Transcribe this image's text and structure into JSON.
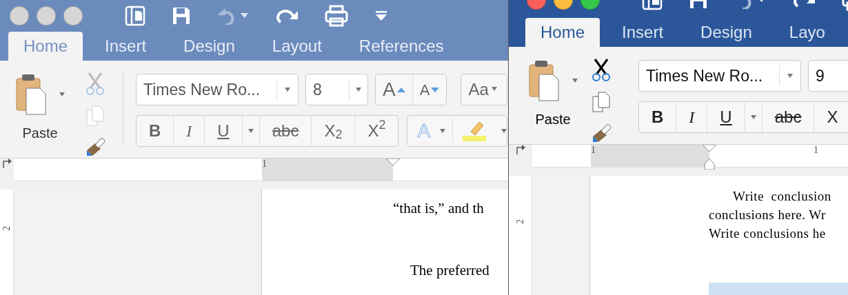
{
  "windows": [
    {
      "active": false,
      "tabs": [
        {
          "label": "Home",
          "selected": true
        },
        {
          "label": "Insert",
          "selected": false
        },
        {
          "label": "Design",
          "selected": false
        },
        {
          "label": "Layout",
          "selected": false
        },
        {
          "label": "References",
          "selected": false
        }
      ],
      "paste_label": "Paste",
      "font_name": "Times New Ro...",
      "font_size": "8",
      "font_tools": [
        {
          "kind": "grow",
          "label": "A"
        },
        {
          "kind": "shrink",
          "label": "A"
        },
        {
          "kind": "case",
          "label": "Aa"
        }
      ],
      "format_buttons": [
        {
          "kind": "bold",
          "label": "B"
        },
        {
          "kind": "italic",
          "label": "I"
        },
        {
          "kind": "underline",
          "label": "U"
        },
        {
          "kind": "strike",
          "label": "abc"
        },
        {
          "kind": "script",
          "label": "X$_{2}$"
        },
        {
          "kind": "script",
          "label": "X$^{2}$"
        }
      ],
      "effects_label": "A",
      "ruler_label": "1",
      "vertical_ruler_label": "2",
      "document_lines": [
        {
          "text": "“that is,” and th",
          "indent": false
        },
        {
          "text": "The preferred",
          "indent": true
        }
      ]
    },
    {
      "active": true,
      "tabs": [
        {
          "label": "Home",
          "selected": true
        },
        {
          "label": "Insert",
          "selected": false
        },
        {
          "label": "Design",
          "selected": false
        },
        {
          "label": "Layo",
          "selected": false
        }
      ],
      "paste_label": "Paste",
      "font_name": "Times New Ro...",
      "font_size": "9",
      "format_buttons": [
        {
          "kind": "bold",
          "label": "B"
        },
        {
          "kind": "italic",
          "label": "I"
        },
        {
          "kind": "underline",
          "label": "U"
        },
        {
          "kind": "strike",
          "label": "abc"
        },
        {
          "kind": "script",
          "label": "X"
        }
      ],
      "ruler_label": "1",
      "ruler_label_2": "1",
      "vertical_ruler_label": "2",
      "document_lines": [
        {
          "text": "Write  conclusion",
          "indent": true
        },
        {
          "text": "conclusions here. Wr",
          "indent": false
        },
        {
          "text": "Write conclusions he",
          "indent": false
        }
      ]
    }
  ]
}
